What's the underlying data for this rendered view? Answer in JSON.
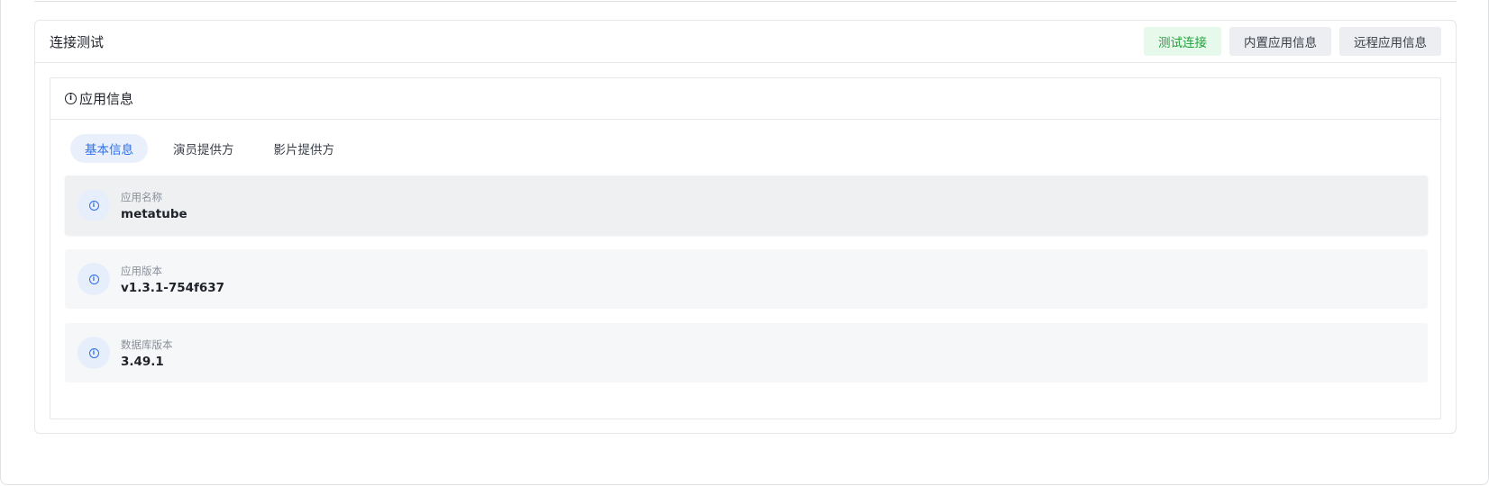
{
  "connection_card": {
    "title": "连接测试",
    "buttons": {
      "test": "测试连接",
      "builtin": "内置应用信息",
      "remote": "远程应用信息"
    }
  },
  "app_info": {
    "title": "应用信息",
    "tabs": [
      "基本信息",
      "演员提供方",
      "影片提供方"
    ],
    "active_tab": "基本信息",
    "items": [
      {
        "label": "应用名称",
        "value": "metatube",
        "icon": "info-icon"
      },
      {
        "label": "应用版本",
        "value": "v1.3.1-754f637",
        "icon": "info-icon"
      },
      {
        "label": "数据库版本",
        "value": "3.49.1",
        "icon": "info-icon"
      }
    ]
  },
  "colors": {
    "accent": "#2f6fe6",
    "success": "#1fa33a",
    "success_bg": "#e6f9ea"
  }
}
